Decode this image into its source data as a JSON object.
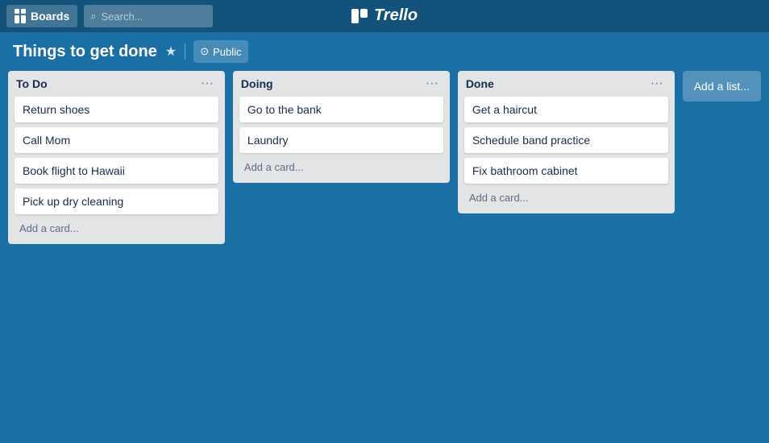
{
  "topnav": {
    "boards_label": "Boards",
    "search_placeholder": "Search..."
  },
  "logo": {
    "text": "Trello"
  },
  "board": {
    "title": "Things to get done",
    "visibility": "Public"
  },
  "lists": [
    {
      "id": "todo",
      "title": "To Do",
      "cards": [
        {
          "text": "Return shoes"
        },
        {
          "text": "Call Mom"
        },
        {
          "text": "Book flight to Hawaii"
        },
        {
          "text": "Pick up dry cleaning"
        }
      ],
      "add_card_label": "Add a card..."
    },
    {
      "id": "doing",
      "title": "Doing",
      "cards": [
        {
          "text": "Go to the bank"
        },
        {
          "text": "Laundry"
        }
      ],
      "add_card_label": "Add a card..."
    },
    {
      "id": "done",
      "title": "Done",
      "cards": [
        {
          "text": "Get a haircut"
        },
        {
          "text": "Schedule band practice"
        },
        {
          "text": "Fix bathroom cabinet"
        }
      ],
      "add_card_label": "Add a card..."
    }
  ],
  "add_list_label": "Add a list..."
}
